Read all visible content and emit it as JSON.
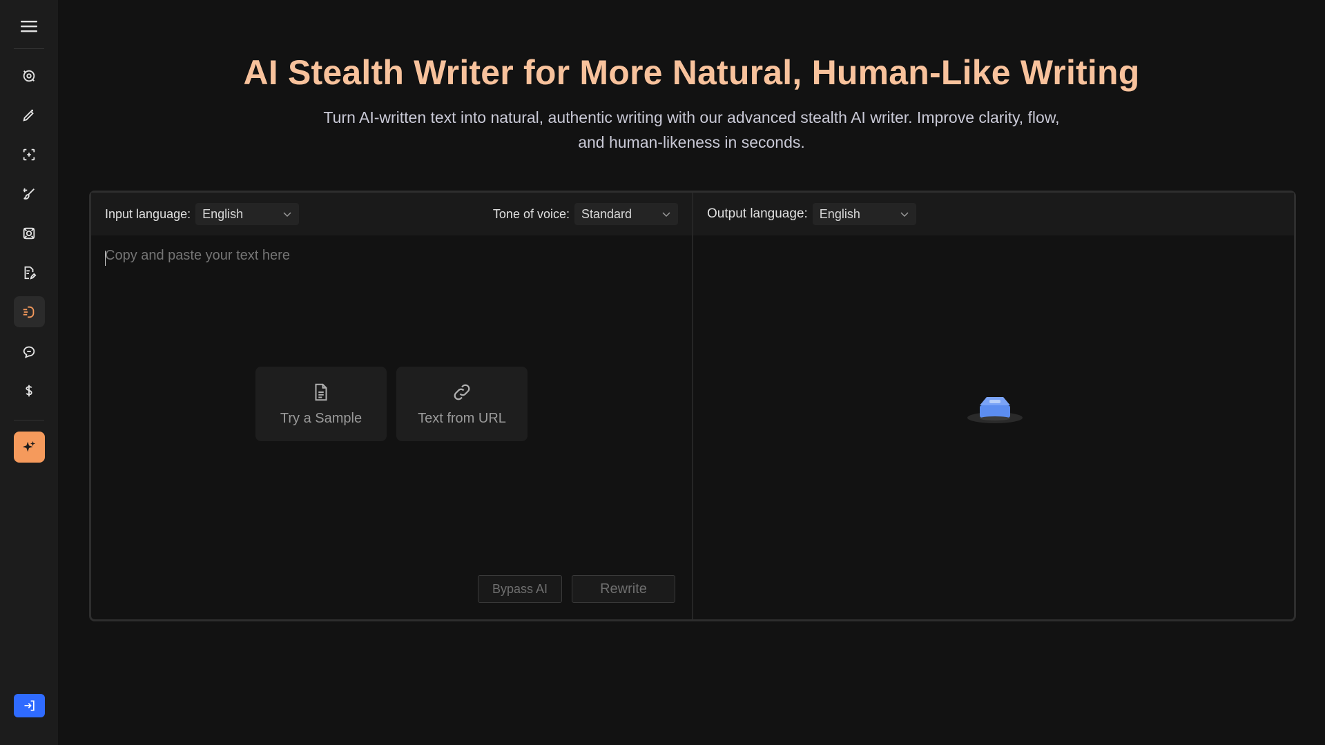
{
  "header": {
    "title": "AI Stealth Writer for More Natural, Human-Like Writing",
    "subtitle": "Turn AI-written text into natural, authentic writing with our advanced stealth AI writer. Improve clarity, flow, and human-likeness in seconds."
  },
  "sidebar": {
    "items": [
      {
        "name": "ai-detector",
        "icon": "scan-circle-icon"
      },
      {
        "name": "humanizer",
        "icon": "pen-sparkle-icon"
      },
      {
        "name": "face-scan",
        "icon": "face-scan-icon"
      },
      {
        "name": "brush",
        "icon": "paint-brush-icon"
      },
      {
        "name": "target",
        "icon": "target-frame-icon"
      },
      {
        "name": "document-edit",
        "icon": "document-edit-icon"
      },
      {
        "name": "stealth-writer",
        "icon": "ghost-writer-icon",
        "active": true
      },
      {
        "name": "chat",
        "icon": "chat-bubble-icon"
      },
      {
        "name": "pricing",
        "icon": "dollar-icon"
      }
    ],
    "special": {
      "icon": "sparkles-icon",
      "color": "#f59a5c"
    },
    "login_color": "#2f6bff"
  },
  "input": {
    "language_label": "Input language:",
    "language_value": "English",
    "tone_label": "Tone of voice:",
    "tone_value": "Standard",
    "placeholder": "Copy and paste your text here",
    "sample_label": "Try a Sample",
    "url_label": "Text from URL",
    "bypass_label": "Bypass AI",
    "rewrite_label": "Rewrite"
  },
  "output": {
    "language_label": "Output language:",
    "language_value": "English"
  },
  "colors": {
    "title": "#f8c29c",
    "background": "#121212",
    "sidebar": "#1c1c1c"
  }
}
